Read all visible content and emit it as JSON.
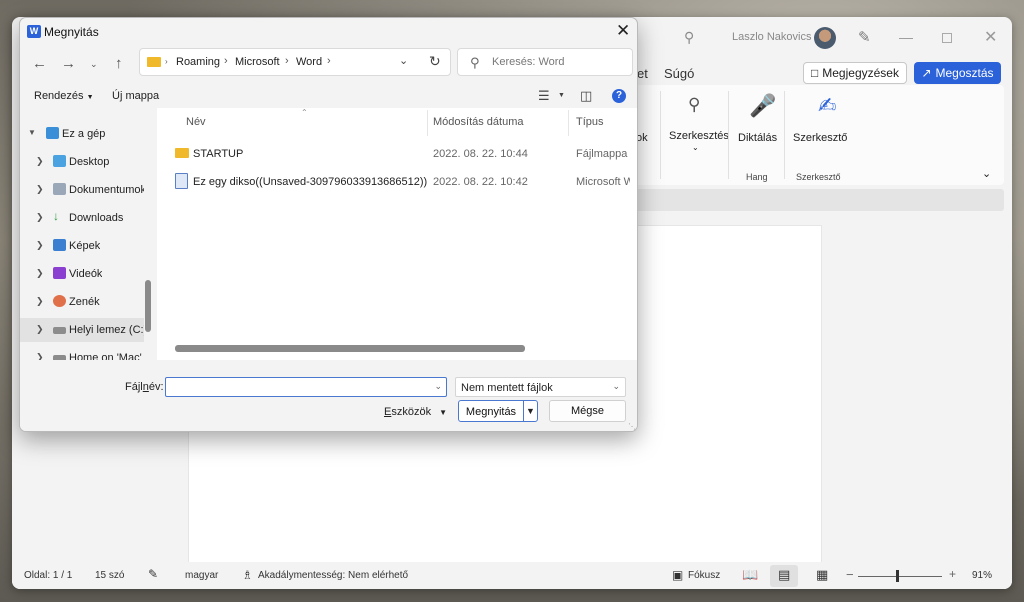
{
  "word": {
    "user_name": "Laszlo Nakovics",
    "menu_partial": "et",
    "menu_help": "Súgó",
    "comments_label": "Megjegyzések",
    "share_label": "Megosztás",
    "ribbon": {
      "partial_label": "ok",
      "edit_label": "Szerkesztés",
      "dictate_label": "Diktálás",
      "editor_label": "Szerkesztő",
      "group_voice": "Hang",
      "group_editor": "Szerkesztő"
    },
    "status": {
      "page": "Oldal: 1 / 1",
      "words": "15 szó",
      "language": "magyar",
      "accessibility": "Akadálymentesség: Nem elérhető",
      "focus": "Fókusz",
      "zoom": "91%",
      "zoom_minus": "−",
      "zoom_plus": "+"
    }
  },
  "dialog": {
    "title": "Megnyitás",
    "breadcrumbs": [
      "Roaming",
      "Microsoft",
      "Word"
    ],
    "search_placeholder": "Keresés: Word",
    "toolbar": {
      "organize": "Rendezés",
      "new_folder": "Új mappa"
    },
    "nav": [
      {
        "label": "Ez a gép",
        "expanded": true
      },
      {
        "label": "Desktop"
      },
      {
        "label": "Dokumentumok"
      },
      {
        "label": "Downloads"
      },
      {
        "label": "Képek"
      },
      {
        "label": "Videók"
      },
      {
        "label": "Zenék"
      },
      {
        "label": "Helyi lemez (C:)"
      },
      {
        "label": "Home on 'Mac'"
      }
    ],
    "columns": {
      "name": "Név",
      "date": "Módosítás dátuma",
      "type": "Típus"
    },
    "files": [
      {
        "name": "STARTUP",
        "date": "2022. 08. 22. 10:44",
        "type": "Fájlmappa"
      },
      {
        "name": "Ez egy dikso((Unsaved-309796033913686512))",
        "date": "2022. 08. 22. 10:42",
        "type": "Microsoft Word"
      }
    ],
    "filename_label_pre": "Fájl",
    "filename_label_u": "n",
    "filename_label_post": "év:",
    "filename_value": "",
    "filter_value": "Nem mentett fájlok",
    "tools_label_u": "E",
    "tools_label_post": "szközök",
    "open_label": "Megnyitás",
    "cancel_label": "Mégse"
  },
  "colors": {
    "accent": "#2b62d9",
    "folder": "#f0b92b"
  }
}
